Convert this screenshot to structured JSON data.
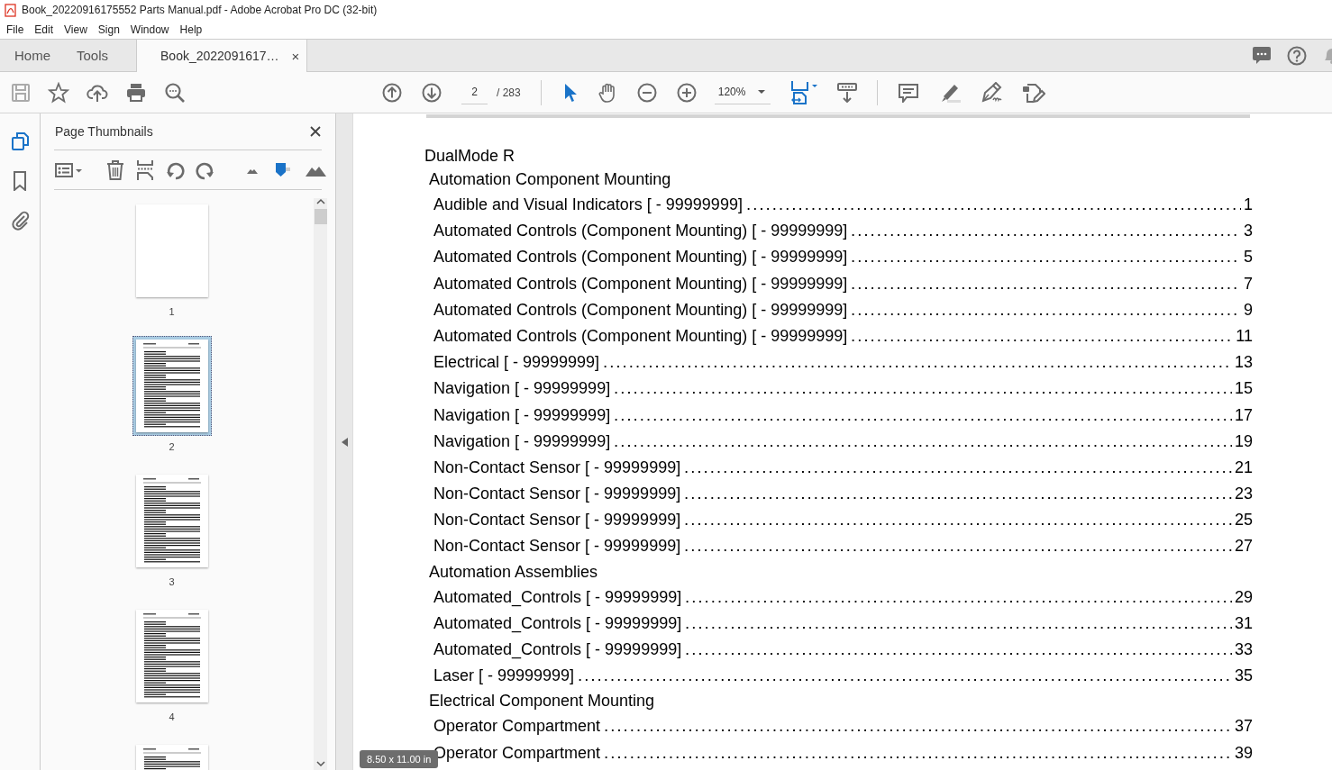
{
  "window": {
    "title": "Book_20220916175552 Parts Manual.pdf - Adobe Acrobat Pro DC (32-bit)"
  },
  "menu": [
    "File",
    "Edit",
    "View",
    "Sign",
    "Window",
    "Help"
  ],
  "tabs": [
    {
      "label": "Home",
      "selected": false
    },
    {
      "label": "Tools",
      "selected": false
    },
    {
      "label": "Book_2022091617…",
      "selected": true,
      "close": "×"
    }
  ],
  "toolbar": {
    "page_current": "2",
    "page_total": "/ 283",
    "zoom": "120%",
    "tools": [
      {
        "kind": "select",
        "selected": true
      },
      {
        "kind": "hand",
        "selected": false
      }
    ]
  },
  "rail": [
    {
      "kind": "pages",
      "selected": true
    },
    {
      "kind": "bookmarks",
      "selected": false
    },
    {
      "kind": "attachments",
      "selected": false
    }
  ],
  "thumbnails_panel": {
    "title": "Page Thumbnails",
    "pages": [
      {
        "label": "1",
        "kind": "blank",
        "selected": false
      },
      {
        "label": "2",
        "kind": "contents",
        "selected": true
      },
      {
        "label": "3",
        "kind": "contents",
        "selected": false
      },
      {
        "label": "4",
        "kind": "contents",
        "selected": false
      },
      {
        "kind": "contents",
        "selected": false
      }
    ]
  },
  "document": {
    "heading": "DualMode R",
    "sections": [
      {
        "title": "Automation Component Mounting",
        "entries": [
          {
            "title": "Audible and Visual Indicators [ - 99999999]",
            "page": "1"
          },
          {
            "title": "Automated Controls (Component Mounting) [ - 99999999]",
            "page": "3"
          },
          {
            "title": "Automated Controls (Component Mounting) [ - 99999999]",
            "page": "5"
          },
          {
            "title": "Automated Controls (Component Mounting) [ - 99999999]",
            "page": "7"
          },
          {
            "title": "Automated Controls (Component Mounting) [ - 99999999]",
            "page": "9"
          },
          {
            "title": "Automated Controls (Component Mounting) [ - 99999999]",
            "page": "11"
          },
          {
            "title": "Electrical [ - 99999999]",
            "page": "13"
          },
          {
            "title": "Navigation [ - 99999999]",
            "page": "15"
          },
          {
            "title": "Navigation [ - 99999999]",
            "page": "17"
          },
          {
            "title": "Navigation [ - 99999999]",
            "page": "19"
          },
          {
            "title": "Non-Contact Sensor [ - 99999999]",
            "page": "21"
          },
          {
            "title": "Non-Contact Sensor [ - 99999999]",
            "page": "23"
          },
          {
            "title": "Non-Contact Sensor [ - 99999999]",
            "page": "25"
          },
          {
            "title": "Non-Contact Sensor [ - 99999999]",
            "page": "27"
          }
        ]
      },
      {
        "title": "Automation Assemblies",
        "entries": [
          {
            "title": "Automated_Controls [ - 99999999]",
            "page": "29"
          },
          {
            "title": "Automated_Controls [ - 99999999]",
            "page": "31"
          },
          {
            "title": "Automated_Controls [ - 99999999]",
            "page": "33"
          },
          {
            "title": "Laser [ - 99999999]",
            "page": "35"
          }
        ]
      },
      {
        "title": "Electrical Component Mounting",
        "entries": [
          {
            "title": "Operator Compartment",
            "page": "37"
          },
          {
            "title": "Operator Compartment",
            "page": "39"
          }
        ]
      }
    ]
  },
  "page_size_tooltip": "8.50 x 11.00 in"
}
